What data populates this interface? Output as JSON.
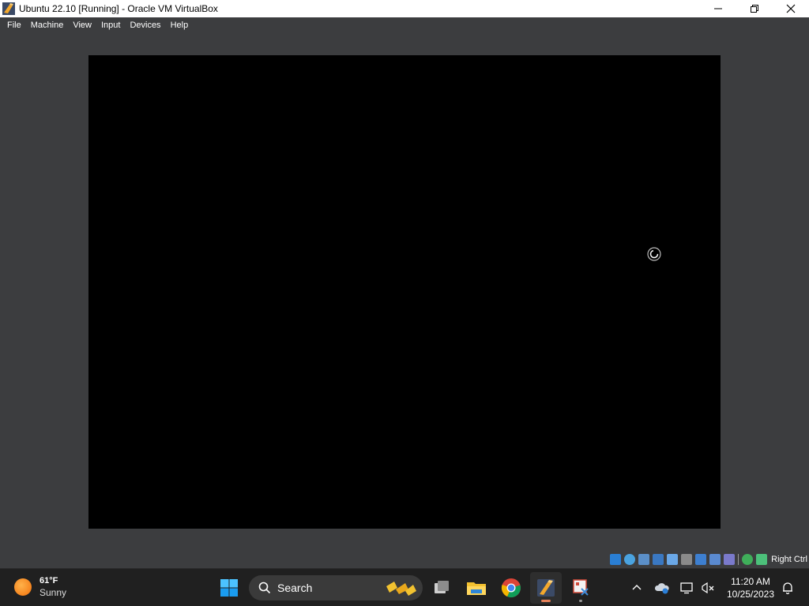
{
  "window": {
    "title": "Ubuntu 22.10 [Running] - Oracle VM VirtualBox",
    "controls": {
      "minimize_icon": "minimize-icon",
      "maximize_icon": "restore-icon",
      "close_icon": "close-icon"
    }
  },
  "menu": {
    "items": [
      {
        "label": "File"
      },
      {
        "label": "Machine"
      },
      {
        "label": "View"
      },
      {
        "label": "Input"
      },
      {
        "label": "Devices"
      },
      {
        "label": "Help"
      }
    ]
  },
  "vm": {
    "state": "Running",
    "screen_color": "#000000",
    "loading_indicator": "spinner-icon"
  },
  "statusbar": {
    "icons": [
      "hard-disk-icon",
      "optical-drive-icon",
      "audio-icon",
      "network-icon",
      "usb-icon",
      "shared-folders-icon",
      "display-icon",
      "recording-icon",
      "cpu-virtualization-icon",
      "mouse-integration-icon",
      "keyboard-capture-icon"
    ],
    "host_key": "Right Ctrl"
  },
  "taskbar": {
    "weather": {
      "temperature": "61°F",
      "condition": "Sunny"
    },
    "search": {
      "label": "Search"
    },
    "apps": [
      "task-view-icon",
      "file-explorer-icon",
      "chrome-icon",
      "virtualbox-icon",
      "snipping-tool-icon"
    ],
    "tray": [
      "show-hidden-icons-icon",
      "onedrive-icon",
      "display-icon",
      "network-icon",
      "notifications-icon"
    ],
    "clock": {
      "time": "11:20 AM",
      "date": "10/25/2023"
    }
  },
  "colors": {
    "titlebar_bg": "#ffffff",
    "menubar_bg": "#3c3d3f",
    "taskbar_bg": "#202020",
    "accent_active": "#e8825a"
  }
}
